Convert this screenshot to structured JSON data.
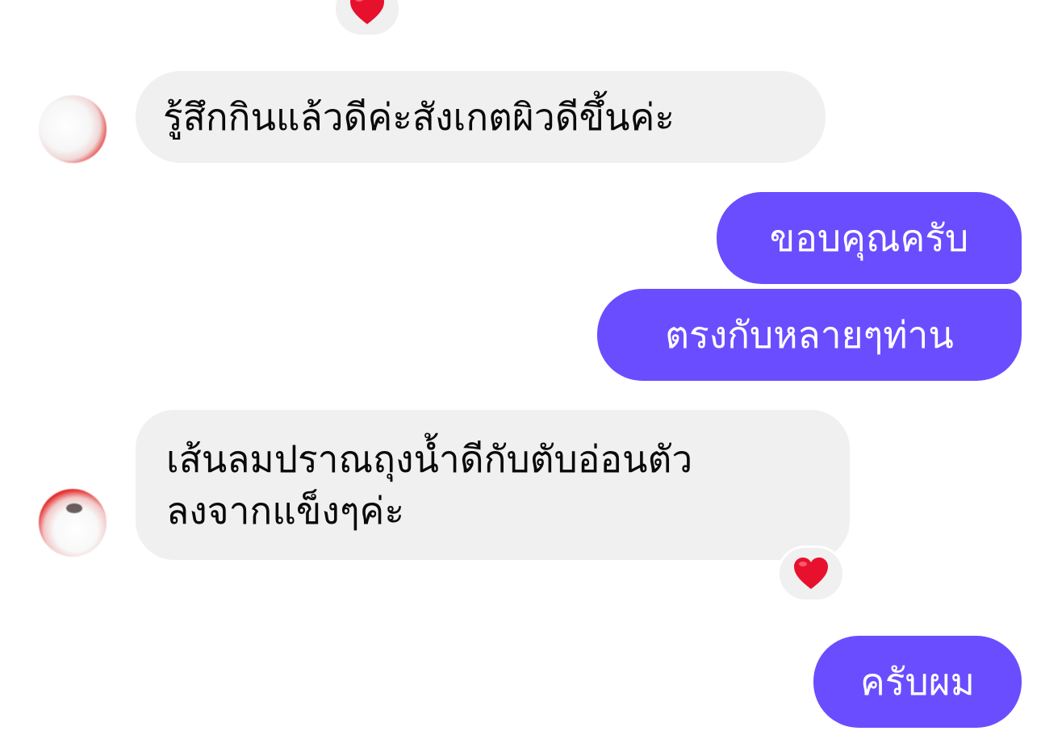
{
  "messages": [
    {
      "direction": "incoming",
      "text": "รู้สึกกินแล้วดีค่ะสังเกตผิวดีขึ้นค่ะ"
    },
    {
      "direction": "outgoing",
      "text": "ขอบคุณครับ"
    },
    {
      "direction": "outgoing",
      "text": "ตรงกับหลายๆท่าน"
    },
    {
      "direction": "incoming",
      "lines": [
        "เส้นลมปราณถุงน้ำดีกับตับอ่อนตัว",
        "ลงจากแข็งๆค่ะ"
      ],
      "reaction": "heart-icon"
    },
    {
      "direction": "outgoing",
      "text": "ครับผม"
    }
  ],
  "reactions": {
    "top": "heart-icon",
    "message_4": "heart-icon"
  },
  "colors": {
    "outgoing_bubble": "#6a4dff",
    "incoming_bubble": "#f0f0f0",
    "heart": "#e8112d"
  }
}
